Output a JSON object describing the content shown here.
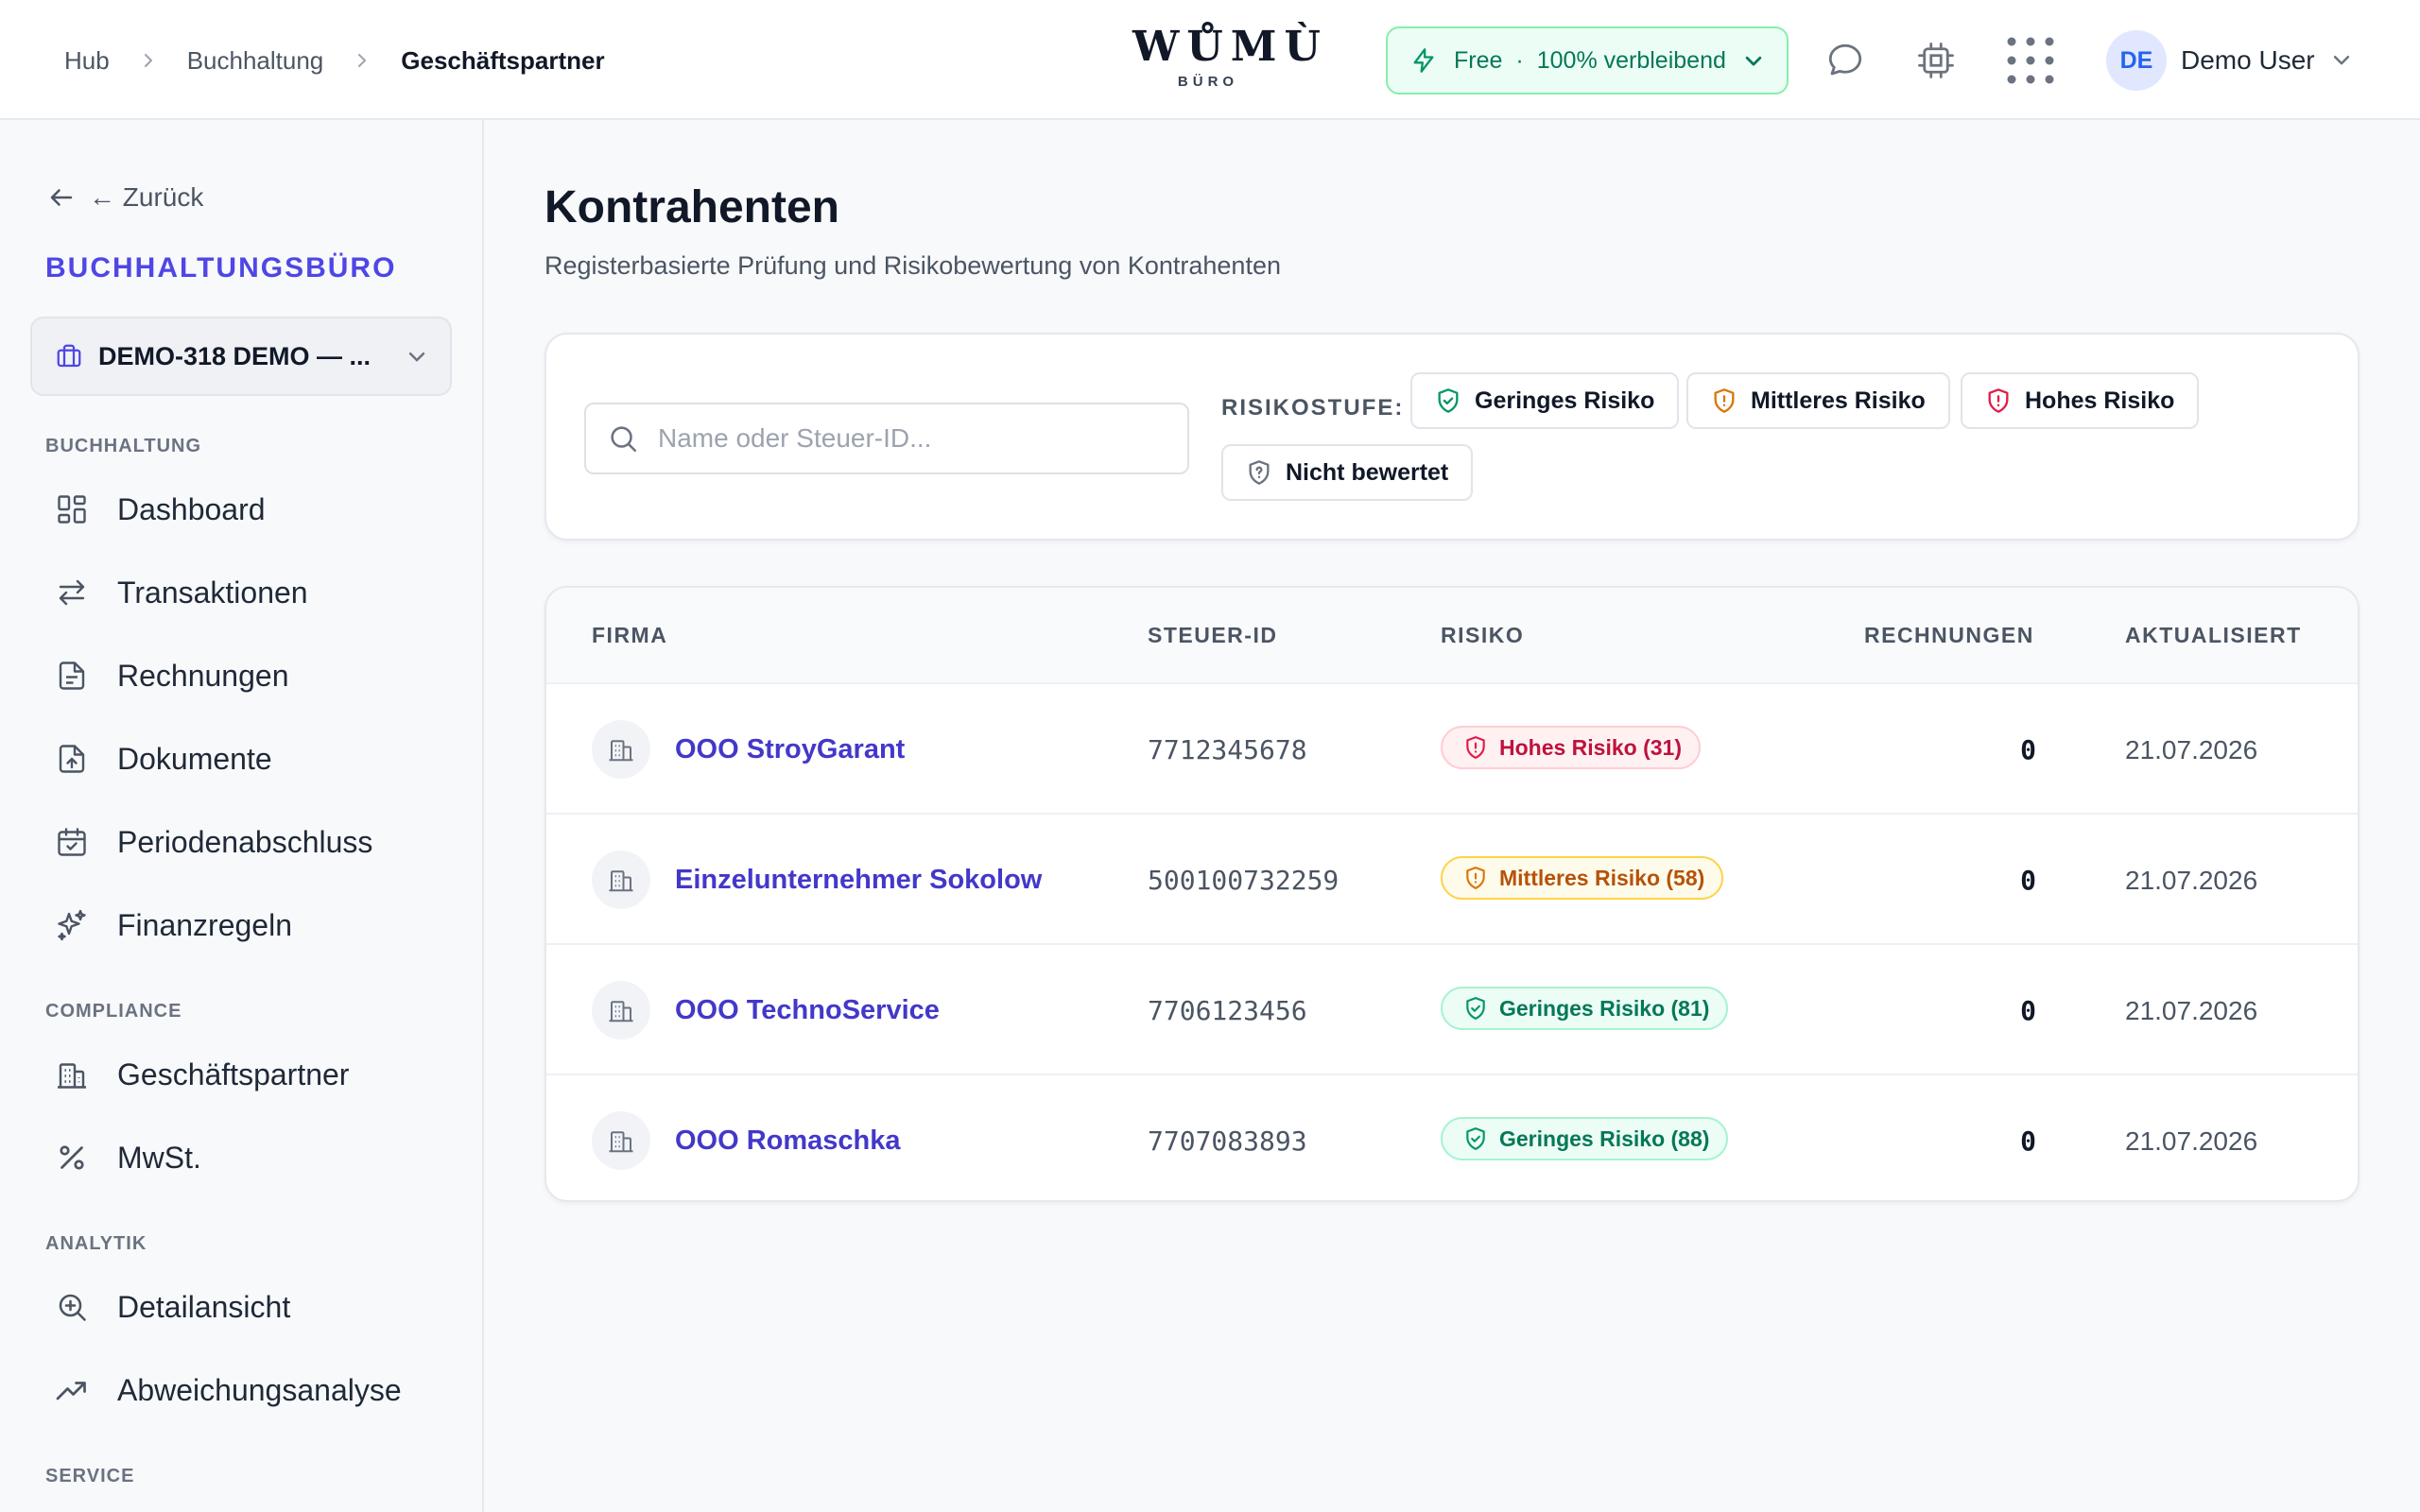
{
  "header": {
    "breadcrumb": [
      "Hub",
      "Buchhaltung",
      "Geschäftspartner"
    ],
    "logo_main": "WŮMÙ",
    "logo_sub": "BÜRO",
    "plan": {
      "name": "Free",
      "separator": "·",
      "status": "100% verbleibend"
    },
    "user": {
      "initials": "DE",
      "name": "Demo User"
    }
  },
  "sidebar": {
    "back_label": "← Zurück",
    "org_title": "BUCHHALTUNGSBÜRO",
    "org_select": "DEMO-318 DEMO — ...",
    "sections": {
      "accounting": "BUCHHALTUNG",
      "compliance": "COMPLIANCE",
      "analytics": "ANALYTIK",
      "service": "SERVICE"
    },
    "items": {
      "dashboard": "Dashboard",
      "transactions": "Transaktionen",
      "invoices": "Rechnungen",
      "documents": "Dokumente",
      "period_close": "Periodenabschluss",
      "finance_rules": "Finanzregeln",
      "partners": "Geschäftspartner",
      "vat": "MwSt.",
      "detail_view": "Detailansicht",
      "deviation": "Abweichungsanalyse"
    }
  },
  "main": {
    "title": "Kontrahenten",
    "subtitle": "Registerbasierte Prüfung und Risikobewertung von Kontrahenten",
    "search_placeholder": "Name oder Steuer-ID...",
    "risk_label": "RISIKOSTUFE:",
    "filters": {
      "low": "Geringes Risiko",
      "mid": "Mittleres Risiko",
      "high": "Hohes Risiko",
      "none": "Nicht bewertet"
    },
    "columns": {
      "firm": "FIRMA",
      "tax_id": "STEUER-ID",
      "risk": "RISIKO",
      "invoices": "RECHNUNGEN",
      "updated": "AKTUALISIERT"
    },
    "rows": [
      {
        "name": "OOO StroyGarant",
        "tax_id": "7712345678",
        "risk": "Hohes Risiko (31)",
        "invoices": "0",
        "updated": "21.07.2026"
      },
      {
        "name": "Einzelunternehmer Sokolow",
        "tax_id": "500100732259",
        "risk": "Mittleres Risiko (58)",
        "invoices": "0",
        "updated": "21.07.2026"
      },
      {
        "name": "OOO TechnoService",
        "tax_id": "7706123456",
        "risk": "Geringes Risiko (81)",
        "invoices": "0",
        "updated": "21.07.2026"
      },
      {
        "name": "OOO Romaschka",
        "tax_id": "7707083893",
        "risk": "Geringes Risiko (88)",
        "invoices": "0",
        "updated": "21.07.2026"
      }
    ]
  },
  "colors": {
    "accent": "#4f46e5",
    "risk_high": "#be123c",
    "risk_mid": "#b45309",
    "risk_low": "#047857"
  },
  "icons": {
    "topbar": [
      "chat-icon",
      "chip-icon",
      "apps-grid-icon"
    ],
    "sidebar": [
      "dashboard-icon",
      "transfer-icon",
      "file-text-icon",
      "file-upload-icon",
      "calendar-check-icon",
      "sparkles-icon",
      "building-icon",
      "percent-icon",
      "zoom-in-icon",
      "trending-up-icon"
    ]
  }
}
